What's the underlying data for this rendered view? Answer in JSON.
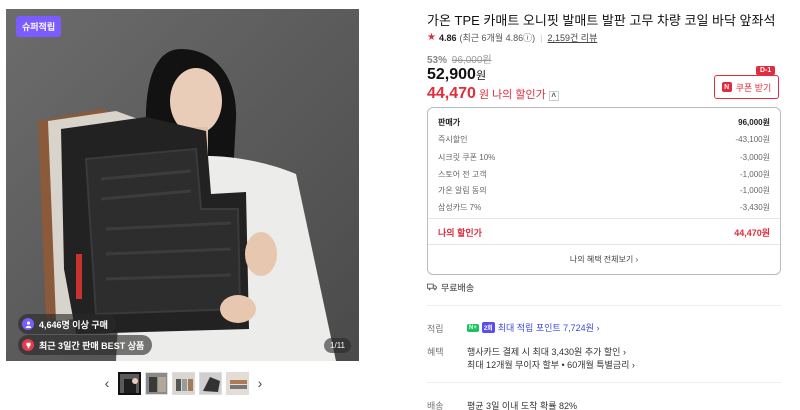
{
  "gallery": {
    "badge": "슈퍼적립",
    "chip_buyers": "4,646명 이상 구매",
    "chip_best": "최근 3일간 판매 BEST 상품",
    "counter": "1/11"
  },
  "product": {
    "title": "가온 TPE 카매트 오니핏 발매트 발판 고무 차량 코일 바닥 앞좌석",
    "rating": "4.86",
    "rating_note": "(최근 6개월 4.86ⓘ)",
    "review_count": "2,159건 리뷰",
    "discount_pct": "53%",
    "original_price": "96,000원",
    "sale_price": "52,900",
    "won": "원",
    "my_price": "44,470",
    "my_price_label": "나의 할인가",
    "coupon_label": "쿠폰 받기",
    "coupon_dday": "D-1"
  },
  "breakdown": {
    "rows": [
      {
        "label": "판매가",
        "value": "96,000원"
      },
      {
        "label": "즉시할인",
        "value": "-43,100원"
      },
      {
        "label": "시크릿 쿠폰 10%",
        "value": "-3,000원"
      },
      {
        "label": "스토어 전 고객",
        "value": "-1,000원"
      },
      {
        "label": "가온 알림 동의",
        "value": "-1,000원"
      },
      {
        "label": "삼성카드 7%",
        "value": "-3,430원"
      }
    ],
    "total_label": "나의 할인가",
    "total_value": "44,470원",
    "all_benefits": "나의 혜택 전체보기 ›"
  },
  "shipping": {
    "free": "무료배송",
    "delivery_label": "배송",
    "delivery_value": "평균 3일 이내 도착 확률 82%"
  },
  "points": {
    "label": "적립",
    "n_badge": "N+",
    "p_badge": "2회",
    "value": "최대 적립 포인트 7,724원 ›"
  },
  "benefits": {
    "label": "혜택",
    "line1": "행사카드 결제 시 최대 3,430원 추가 할인 ›",
    "line2": "최대 12개월 무이자 할부 • 60개월 특별금리 ›"
  },
  "colors": {
    "accent_red": "#e02c3e",
    "badge_purple": "#7b5cff",
    "point_blue": "#3a4cd8"
  }
}
